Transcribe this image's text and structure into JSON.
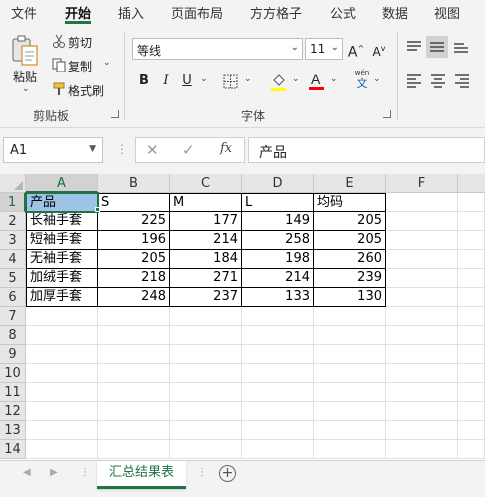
{
  "tabs": [
    "文件",
    "开始",
    "插入",
    "页面布局",
    "方方格子",
    "公式",
    "数据",
    "视图"
  ],
  "active_tab": "开始",
  "clipboard": {
    "paste_label": "粘贴",
    "cut_label": "剪切",
    "copy_label": "复制",
    "format_painter_label": "格式刷",
    "group_label": "剪贴板"
  },
  "font": {
    "font_name": "等线",
    "font_size": "11",
    "bold": "B",
    "italic": "I",
    "underline": "U",
    "grow": "A",
    "shrink": "A",
    "phonetic_top": "wén",
    "phonetic_bottom": "文",
    "group_label": "字体",
    "fill_color": "#ffff00",
    "font_color": "#ff0000"
  },
  "formula_bar": {
    "name_box": "A1",
    "fx": "fx",
    "formula": "产品"
  },
  "columns": [
    "A",
    "B",
    "C",
    "D",
    "E",
    "F"
  ],
  "rows": [
    "1",
    "2",
    "3",
    "4",
    "5",
    "6",
    "7",
    "8",
    "9",
    "10",
    "11",
    "12",
    "13",
    "14"
  ],
  "table": {
    "headers": [
      "产品",
      "S",
      "M",
      "L",
      "均码"
    ],
    "rows": [
      [
        "长袖手套",
        "225",
        "177",
        "149",
        "205"
      ],
      [
        "短袖手套",
        "196",
        "214",
        "258",
        "205"
      ],
      [
        "无袖手套",
        "205",
        "184",
        "198",
        "260"
      ],
      [
        "加绒手套",
        "218",
        "271",
        "214",
        "239"
      ],
      [
        "加厚手套",
        "248",
        "237",
        "133",
        "130"
      ]
    ]
  },
  "sheet": {
    "active_sheet": "汇总结果表",
    "add_sheet": "+"
  },
  "accent_color": "#217346"
}
